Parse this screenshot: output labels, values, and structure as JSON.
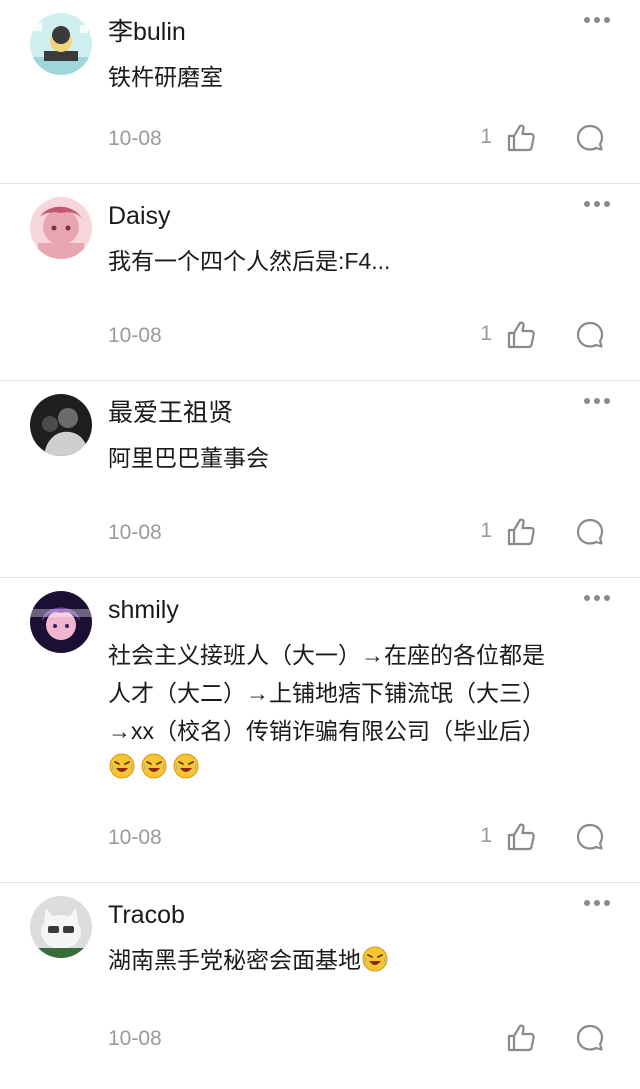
{
  "comments": [
    {
      "username": "李bulin",
      "content_lines": [
        "铁杵研磨室"
      ],
      "date": "10-08",
      "like_count": "1",
      "avatar_colors": [
        "#cfeef0",
        "#3a3a3a",
        "#f2d27a"
      ]
    },
    {
      "username": "Daisy",
      "content_lines": [
        "我有一个四个人然后是:F4..."
      ],
      "date": "10-08",
      "like_count": "1",
      "avatar_colors": [
        "#f7d6dc",
        "#e8a6b2",
        "#c15a6f"
      ]
    },
    {
      "username": "最爱王祖贤",
      "content_lines": [
        "阿里巴巴董事会"
      ],
      "date": "10-08",
      "like_count": "1",
      "avatar_colors": [
        "#1e1e1e",
        "#6b6b6b",
        "#cfcfcf"
      ]
    },
    {
      "username": "shmily",
      "content_lines": [
        "社会主义接班人（大一）→在座的各位都是",
        "人才（大二）→上铺地痞下铺流氓（大三）",
        "→xx（校名）传销诈骗有限公司（毕业后）"
      ],
      "emoji_names": [
        "rofl-emoji",
        "rofl-emoji",
        "rofl-emoji"
      ],
      "date": "10-08",
      "like_count": "1",
      "avatar_colors": [
        "#1b1033",
        "#6a3fa0",
        "#f0b6d0"
      ]
    },
    {
      "username": "Tracob",
      "content_lines": [
        "湖南黑手党秘密会面基地"
      ],
      "trailing_emoji": "rofl-emoji",
      "date": "10-08",
      "like_count": "",
      "avatar_colors": [
        "#dcdcdc",
        "#f5f5f5",
        "#3a6b3a"
      ]
    }
  ],
  "colors": {
    "text_primary": "#1a1a1a",
    "text_secondary": "#9a9a9a",
    "divider": "#e2e2e2",
    "icon": "#8a8a8a",
    "emoji_face": "#f7c531"
  },
  "icons": {
    "more": "more-horizontal-icon",
    "like": "thumbs-up-icon",
    "reply": "comment-bubble-icon"
  }
}
